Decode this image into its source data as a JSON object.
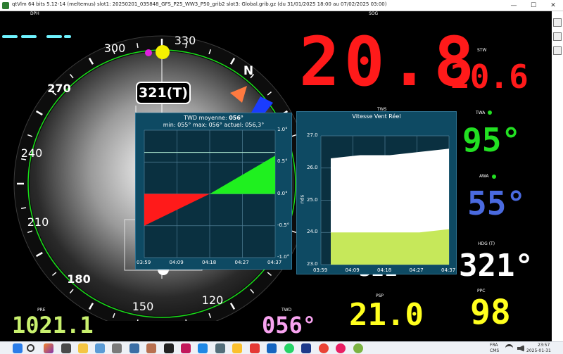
{
  "window": {
    "title": "qtVlm 64 bits 5.12-14 (meltemus) slot1: 20250201_035848_GFS_P25_WW3_P50_grib2 slot3: Global.grib.gz (du 31/01/2025 18:00 au 07/02/2025 03:00)",
    "minimize": "—",
    "maximize": "☐",
    "close": "✕"
  },
  "labels": {
    "dph": "DPH",
    "sog": "SOG",
    "stw": "STW",
    "tws": "TWS",
    "twa": "TWA",
    "awa": "AWA",
    "hdg": "HDG (T)",
    "pre": "PRE",
    "twd": "TWD",
    "psp": "PSP",
    "ppc": "PPC"
  },
  "values": {
    "sog": "20.8",
    "stw": "20.6",
    "twa": "95°",
    "awa": "55°",
    "hdg": "321°",
    "pre": "1021.1",
    "twd": "056°",
    "psp": "21.0",
    "ppc": "98",
    "hidden_left": "321°"
  },
  "colors": {
    "sog": "#ff1a1a",
    "stw": "#ff1a1a",
    "twa": "#22e022",
    "awa": "#4a6adf",
    "hdg": "#ffffff",
    "pre": "#c8f06e",
    "twd": "#f8a3f0",
    "psp": "#ffff1e",
    "ppc": "#ffff1e",
    "dot": "#22e022"
  },
  "compass": {
    "heading_box": "321(T)",
    "north": "N",
    "labels": [
      "330",
      "300",
      "270",
      "240",
      "210",
      "180",
      "150",
      "120"
    ]
  },
  "twd_panel": {
    "line1_prefix": "TWD moyenne: ",
    "line1_value": "056°",
    "line2": "min: 055° max: 056° actuel: 056,3°",
    "y_ticks": [
      "1.0°",
      "0.5°",
      "0.0°",
      "-0.5°",
      "-1.0°"
    ],
    "x_ticks": [
      "03:59",
      "04:09",
      "04:18",
      "04:27",
      "04:37"
    ]
  },
  "tws_panel": {
    "title": "Vitesse Vent Réel",
    "y_unit": "nds",
    "y_ticks": [
      "27.0",
      "26.0",
      "25.0",
      "24.0",
      "23.0"
    ],
    "x_ticks": [
      "03:59",
      "04:09",
      "04:18",
      "04:27",
      "04:37"
    ]
  },
  "chart_data": [
    {
      "type": "area",
      "title": "TWD moyenne: 056°",
      "xlabel": "",
      "ylabel": "",
      "ylim": [
        -1.0,
        1.0
      ],
      "x": [
        "03:59",
        "04:09",
        "04:18",
        "04:27",
        "04:37"
      ],
      "series": [
        {
          "values": [
            -0.5,
            -0.25,
            0.0,
            0.3,
            0.6
          ]
        }
      ],
      "reference_line": 0.65,
      "grid": true
    },
    {
      "type": "area",
      "title": "Vitesse Vent Réel",
      "xlabel": "",
      "ylabel": "nds",
      "ylim": [
        23.0,
        27.0
      ],
      "x": [
        "03:59",
        "04:09",
        "04:18",
        "04:27",
        "04:37"
      ],
      "series": [
        {
          "values": [
            26.3,
            26.4,
            26.4,
            26.5,
            26.6
          ]
        },
        {
          "values": [
            24.0,
            24.0,
            24.0,
            24.0,
            24.1
          ]
        }
      ],
      "grid": true
    }
  ],
  "taskbar": {
    "lang1": "FRA",
    "lang2": "CMS",
    "time": "23:57",
    "date": "2025-01-31"
  }
}
